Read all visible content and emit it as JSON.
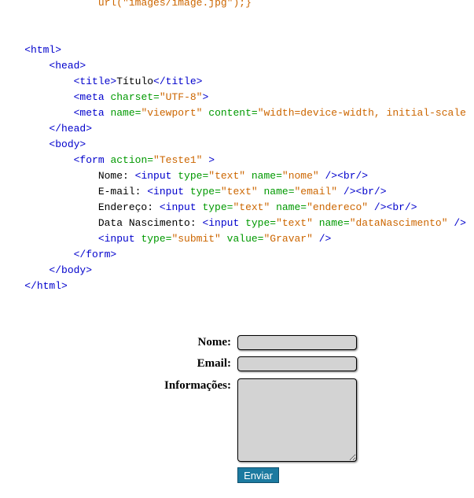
{
  "code_lines": [
    {
      "indent": "                ",
      "segments": [
        {
          "t": "url(",
          "c": "str"
        },
        {
          "t": "\"images/image.jpg\"",
          "c": "str"
        },
        {
          "t": ");}",
          "c": "str"
        }
      ]
    },
    {
      "indent": "",
      "segments": []
    },
    {
      "indent": "",
      "segments": []
    },
    {
      "indent": "    ",
      "segments": [
        {
          "t": "<html>",
          "c": "tag"
        }
      ]
    },
    {
      "indent": "        ",
      "segments": [
        {
          "t": "<head>",
          "c": "tag"
        }
      ]
    },
    {
      "indent": "            ",
      "segments": [
        {
          "t": "<title>",
          "c": "tag"
        },
        {
          "t": "Título",
          "c": "plain"
        },
        {
          "t": "</title>",
          "c": "tag"
        }
      ]
    },
    {
      "indent": "            ",
      "segments": [
        {
          "t": "<meta ",
          "c": "tag"
        },
        {
          "t": "charset=",
          "c": "attr"
        },
        {
          "t": "\"UTF-8\"",
          "c": "str"
        },
        {
          "t": ">",
          "c": "tag"
        }
      ]
    },
    {
      "indent": "            ",
      "segments": [
        {
          "t": "<meta ",
          "c": "tag"
        },
        {
          "t": "name=",
          "c": "attr"
        },
        {
          "t": "\"viewport\"",
          "c": "str"
        },
        {
          "t": " content=",
          "c": "attr"
        },
        {
          "t": "\"width=device-width, initial-scale",
          "c": "str"
        }
      ]
    },
    {
      "indent": "        ",
      "segments": [
        {
          "t": "</head>",
          "c": "tag"
        }
      ]
    },
    {
      "indent": "        ",
      "segments": [
        {
          "t": "<body>",
          "c": "tag"
        }
      ]
    },
    {
      "indent": "            ",
      "segments": [
        {
          "t": "<form ",
          "c": "tag"
        },
        {
          "t": "action=",
          "c": "attr"
        },
        {
          "t": "\"Teste1\"",
          "c": "str"
        },
        {
          "t": " >",
          "c": "tag"
        }
      ]
    },
    {
      "indent": "                ",
      "segments": [
        {
          "t": "Nome: ",
          "c": "plain"
        },
        {
          "t": "<input ",
          "c": "tag"
        },
        {
          "t": "type=",
          "c": "attr"
        },
        {
          "t": "\"text\"",
          "c": "str"
        },
        {
          "t": " name=",
          "c": "attr"
        },
        {
          "t": "\"nome\"",
          "c": "str"
        },
        {
          "t": " /><br/>",
          "c": "tag"
        }
      ]
    },
    {
      "indent": "                ",
      "segments": [
        {
          "t": "E-mail: ",
          "c": "plain"
        },
        {
          "t": "<input ",
          "c": "tag"
        },
        {
          "t": "type=",
          "c": "attr"
        },
        {
          "t": "\"text\"",
          "c": "str"
        },
        {
          "t": " name=",
          "c": "attr"
        },
        {
          "t": "\"email\"",
          "c": "str"
        },
        {
          "t": " /><br/>",
          "c": "tag"
        }
      ]
    },
    {
      "indent": "                ",
      "segments": [
        {
          "t": "Endereço: ",
          "c": "plain"
        },
        {
          "t": "<input ",
          "c": "tag"
        },
        {
          "t": "type=",
          "c": "attr"
        },
        {
          "t": "\"text\"",
          "c": "str"
        },
        {
          "t": " name=",
          "c": "attr"
        },
        {
          "t": "\"endereco\"",
          "c": "str"
        },
        {
          "t": " /><br/>",
          "c": "tag"
        }
      ]
    },
    {
      "indent": "                ",
      "segments": [
        {
          "t": "Data Nascimento: ",
          "c": "plain"
        },
        {
          "t": "<input ",
          "c": "tag"
        },
        {
          "t": "type=",
          "c": "attr"
        },
        {
          "t": "\"text\"",
          "c": "str"
        },
        {
          "t": " name=",
          "c": "attr"
        },
        {
          "t": "\"dataNascimento\"",
          "c": "str"
        },
        {
          "t": " />",
          "c": "tag"
        }
      ]
    },
    {
      "indent": "                ",
      "segments": [
        {
          "t": "<input ",
          "c": "tag"
        },
        {
          "t": "type=",
          "c": "attr"
        },
        {
          "t": "\"submit\"",
          "c": "str"
        },
        {
          "t": " value=",
          "c": "attr"
        },
        {
          "t": "\"Gravar\"",
          "c": "str"
        },
        {
          "t": " />",
          "c": "tag"
        }
      ]
    },
    {
      "indent": "            ",
      "segments": [
        {
          "t": "</form>",
          "c": "tag"
        }
      ]
    },
    {
      "indent": "        ",
      "segments": [
        {
          "t": "</body>",
          "c": "tag"
        }
      ]
    },
    {
      "indent": "    ",
      "segments": [
        {
          "t": "</html>",
          "c": "tag"
        }
      ]
    }
  ],
  "form": {
    "nome_label": "Nome:",
    "nome_value": "",
    "email_label": "Email:",
    "email_value": "",
    "info_label": "Informações:",
    "info_value": "",
    "submit_label": "Enviar"
  },
  "colors": {
    "code_tag": "#0000cc",
    "code_attr": "#009900",
    "code_string": "#cc6600",
    "field_background": "#d3d3d3",
    "button_background": "#1c7aa0"
  }
}
